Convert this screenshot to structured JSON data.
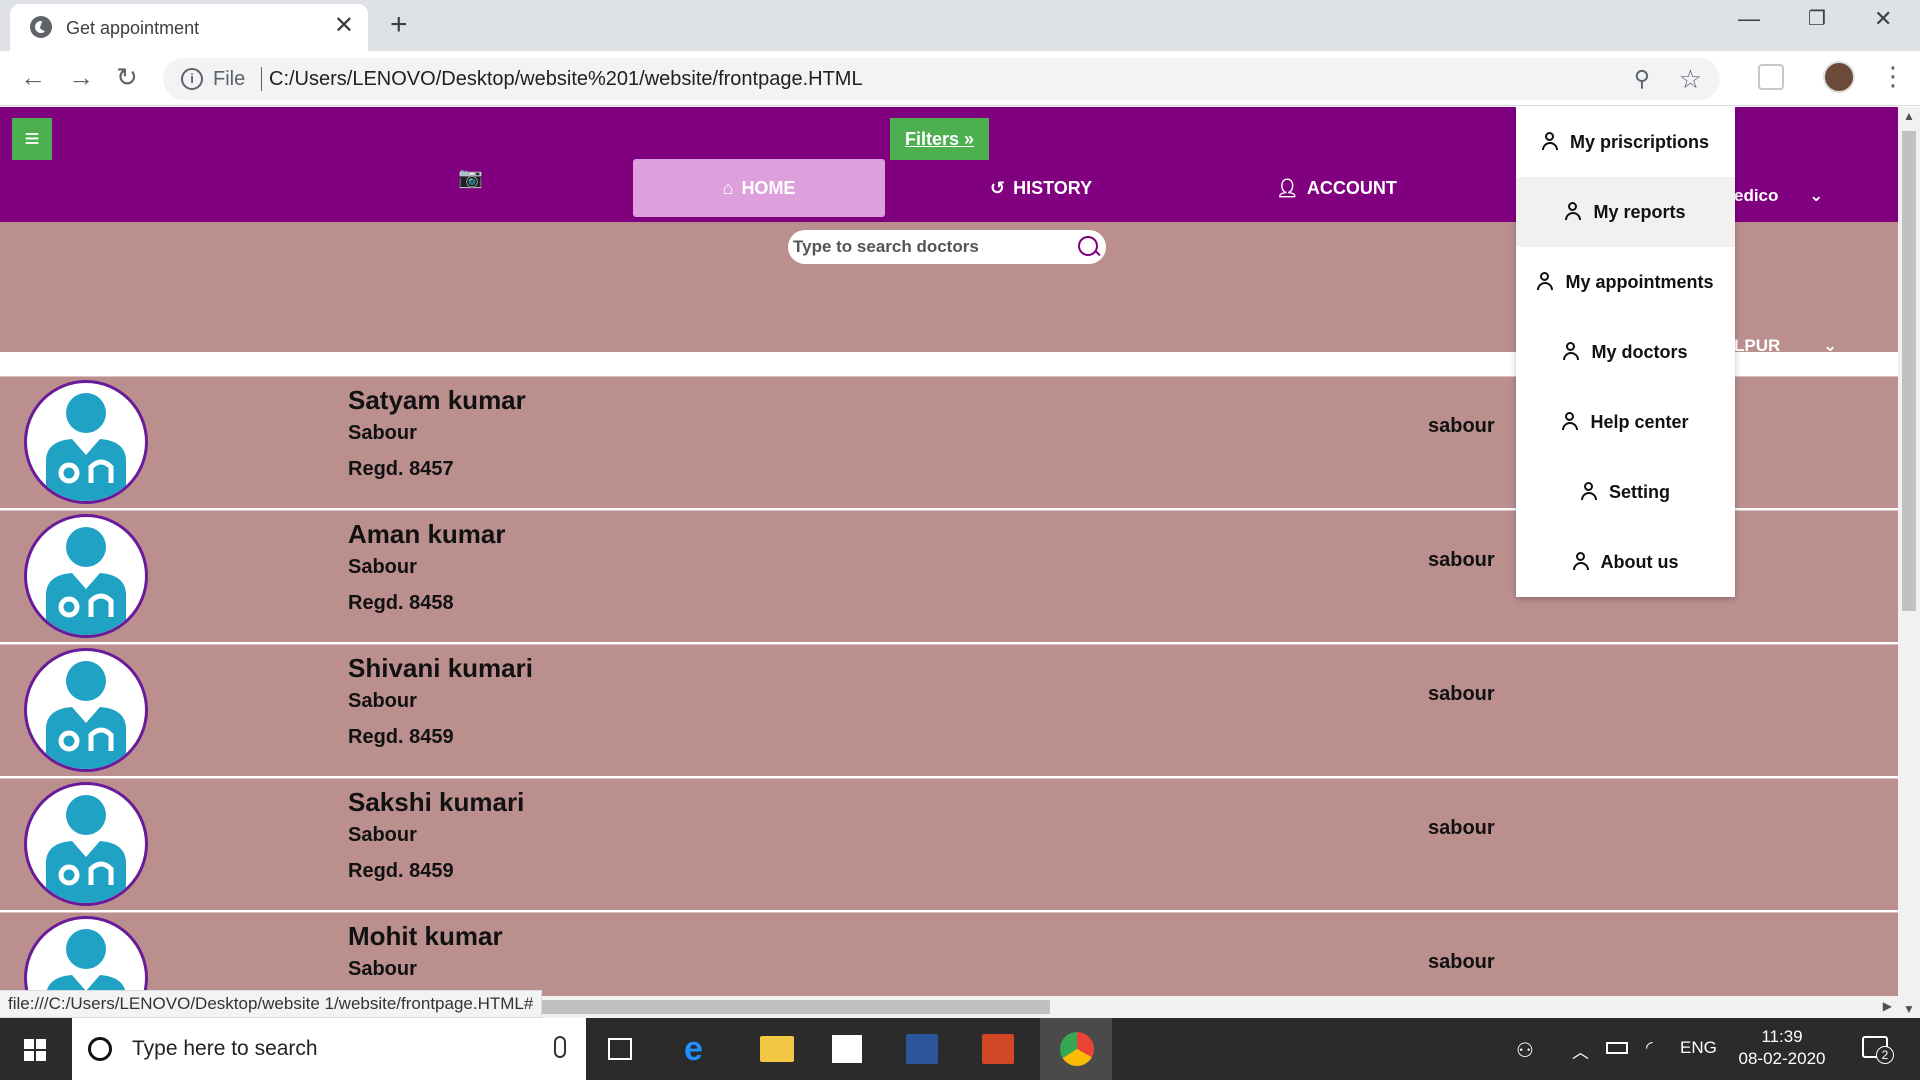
{
  "browser": {
    "tab_title": "Get appointment",
    "tab_close": "✕",
    "new_tab": "+",
    "scheme": "File",
    "url": "C:/Users/LENOVO/Desktop/website%201/website/frontpage.HTML",
    "status_url": "file:///C:/Users/LENOVO/Desktop/website 1/website/frontpage.HTML#"
  },
  "header": {
    "filters_label": "Filters",
    "nav": {
      "home": "HOME",
      "history": "HISTORY",
      "account": "ACCOUNT"
    },
    "right_select_1": "edico",
    "right_select_2": "LPUR"
  },
  "search": {
    "placeholder": "Type to search doctors"
  },
  "doctors": [
    {
      "name": "Satyam kumar",
      "location": "Sabour",
      "regd": "Regd. 8457",
      "city": "sabour"
    },
    {
      "name": "Aman kumar",
      "location": "Sabour",
      "regd": "Regd. 8458",
      "city": "sabour"
    },
    {
      "name": "Shivani kumari",
      "location": "Sabour",
      "regd": "Regd. 8459",
      "city": "sabour"
    },
    {
      "name": "Sakshi kumari",
      "location": "Sabour",
      "regd": "Regd. 8459",
      "city": "sabour"
    },
    {
      "name": "Mohit kumar",
      "location": "Sabour",
      "regd": "",
      "city": "sabour"
    }
  ],
  "account_menu": [
    {
      "label": "My priscriptions"
    },
    {
      "label": "My reports"
    },
    {
      "label": "My appointments"
    },
    {
      "label": "My doctors"
    },
    {
      "label": "Help center"
    },
    {
      "label": "Setting"
    },
    {
      "label": "About us"
    }
  ],
  "taskbar": {
    "search_placeholder": "Type here to search",
    "lang": "ENG",
    "time": "11:39",
    "date": "08-02-2020",
    "notification_count": "2"
  },
  "colors": {
    "header": "#800080",
    "band": "#bc8f8f",
    "home_active": "#dda0dd",
    "filters": "#4caf50",
    "avatar_accent": "#1fa2c4"
  }
}
